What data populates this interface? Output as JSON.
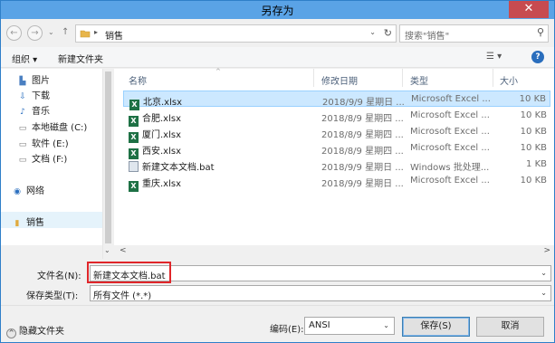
{
  "window": {
    "title": "另存为",
    "close_glyph": "✕"
  },
  "nav": {
    "back_glyph": "←",
    "forward_glyph": "→",
    "recent_glyph": "⌄",
    "up_glyph": "↑",
    "breadcrumb_sep": "▸",
    "breadcrumb": "销售",
    "address_dropdown": "⌄",
    "refresh_glyph": "↻",
    "search_placeholder": "搜索\"销售\"",
    "search_glyph": "⚲"
  },
  "toolbar": {
    "organize_label": "组织 ▾",
    "new_folder_label": "新建文件夹",
    "view_glyph": "☰ ▾",
    "help_glyph": "?"
  },
  "sidebar": {
    "items": [
      {
        "label": "图片",
        "icon": "▙"
      },
      {
        "label": "下载",
        "icon": "⇩"
      },
      {
        "label": "音乐",
        "icon": "♪"
      },
      {
        "label": "本地磁盘 (C:)",
        "icon": "▭"
      },
      {
        "label": "软件 (E:)",
        "icon": "▭"
      },
      {
        "label": "文档 (F:)",
        "icon": "▭"
      },
      {
        "label": "网络",
        "icon": "◉"
      },
      {
        "label": "销售",
        "icon": "▮"
      }
    ],
    "scroll_down_glyph": "⌄"
  },
  "files": {
    "headers": {
      "name": "名称",
      "date": "修改日期",
      "type": "类型",
      "size": "大小"
    },
    "sort_glyph": "^",
    "excel_icon_text": "X",
    "rows": [
      {
        "name": "北京.xlsx",
        "date": "2018/9/9 星期日 ...",
        "type": "Microsoft Excel ...",
        "size": "10 KB",
        "kind": "excel"
      },
      {
        "name": "合肥.xlsx",
        "date": "2018/8/9 星期四 ...",
        "type": "Microsoft Excel ...",
        "size": "10 KB",
        "kind": "excel"
      },
      {
        "name": "厦门.xlsx",
        "date": "2018/8/9 星期四 ...",
        "type": "Microsoft Excel ...",
        "size": "10 KB",
        "kind": "excel"
      },
      {
        "name": "西安.xlsx",
        "date": "2018/8/9 星期四 ...",
        "type": "Microsoft Excel ...",
        "size": "10 KB",
        "kind": "excel"
      },
      {
        "name": "新建文本文档.bat",
        "date": "2018/9/9 星期日 ...",
        "type": "Windows 批处理...",
        "size": "1 KB",
        "kind": "bat"
      },
      {
        "name": "重庆.xlsx",
        "date": "2018/9/9 星期日 ...",
        "type": "Microsoft Excel ...",
        "size": "10 KB",
        "kind": "excel"
      }
    ],
    "scroll_left_glyph": "<",
    "scroll_right_glyph": ">"
  },
  "form": {
    "filename_label": "文件名(N):",
    "filename_value": "新建文本文档.bat",
    "filetype_label": "保存类型(T):",
    "filetype_value": "所有文件 (*.*)",
    "dropdown_glyph": "⌄"
  },
  "footer": {
    "hide_folders_icon": "^",
    "hide_folders_label": "隐藏文件夹",
    "encoding_label": "编码(E):",
    "encoding_value": "ANSI",
    "save_label": "保存(S)",
    "cancel_label": "取消"
  }
}
